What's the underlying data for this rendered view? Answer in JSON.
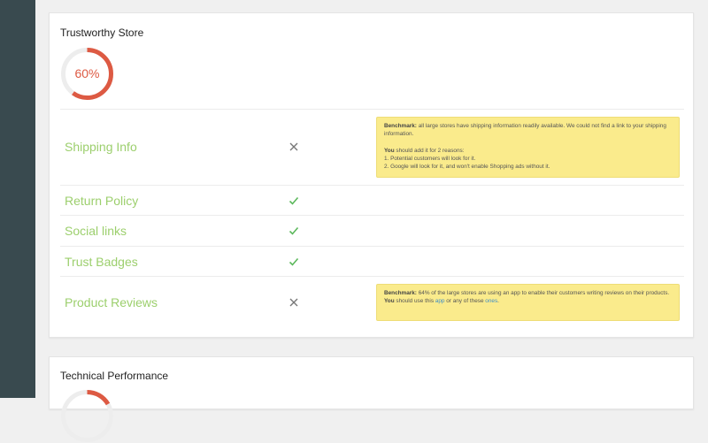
{
  "sections": [
    {
      "title": "Trustworthy Store",
      "score": 60,
      "score_label": "60%",
      "score_color": "#dd5a43",
      "items": [
        {
          "label": "Shipping Info",
          "status": "fail",
          "note": {
            "benchmark_label": "Benchmark:",
            "benchmark_text": " all large stores have shipping information readily available. We could not find a link to your shipping information.",
            "you_label": "You",
            "you_text": " should add it for 2 reasons:",
            "reason_1": "1. Potential customers will look for it.",
            "reason_2": "2. Google will look for it, and won't enable Shopping ads without it."
          }
        },
        {
          "label": "Return Policy",
          "status": "pass"
        },
        {
          "label": "Social links",
          "status": "pass"
        },
        {
          "label": "Trust Badges",
          "status": "pass"
        },
        {
          "label": "Product Reviews",
          "status": "fail",
          "note": {
            "benchmark_label": "Benchmark:",
            "benchmark_text": " 64% of the large stores are using an app to enable their customers writing reviews on their products.",
            "you_label": "You",
            "you_text": " should use this ",
            "link_1": "app",
            "mid_text": " or any of these ",
            "link_2": "ones",
            "end_text": "."
          }
        }
      ]
    },
    {
      "title": "Technical Performance"
    }
  ],
  "colors": {
    "sidebar": "#394a4f",
    "label_green": "#9ccf6d",
    "check_green": "#5cb85c",
    "cross_gray": "#777777",
    "note_bg": "#faeb8c",
    "link_blue": "#3d8ec9"
  },
  "icons": {
    "pass": "check-icon",
    "fail": "cross-icon"
  }
}
